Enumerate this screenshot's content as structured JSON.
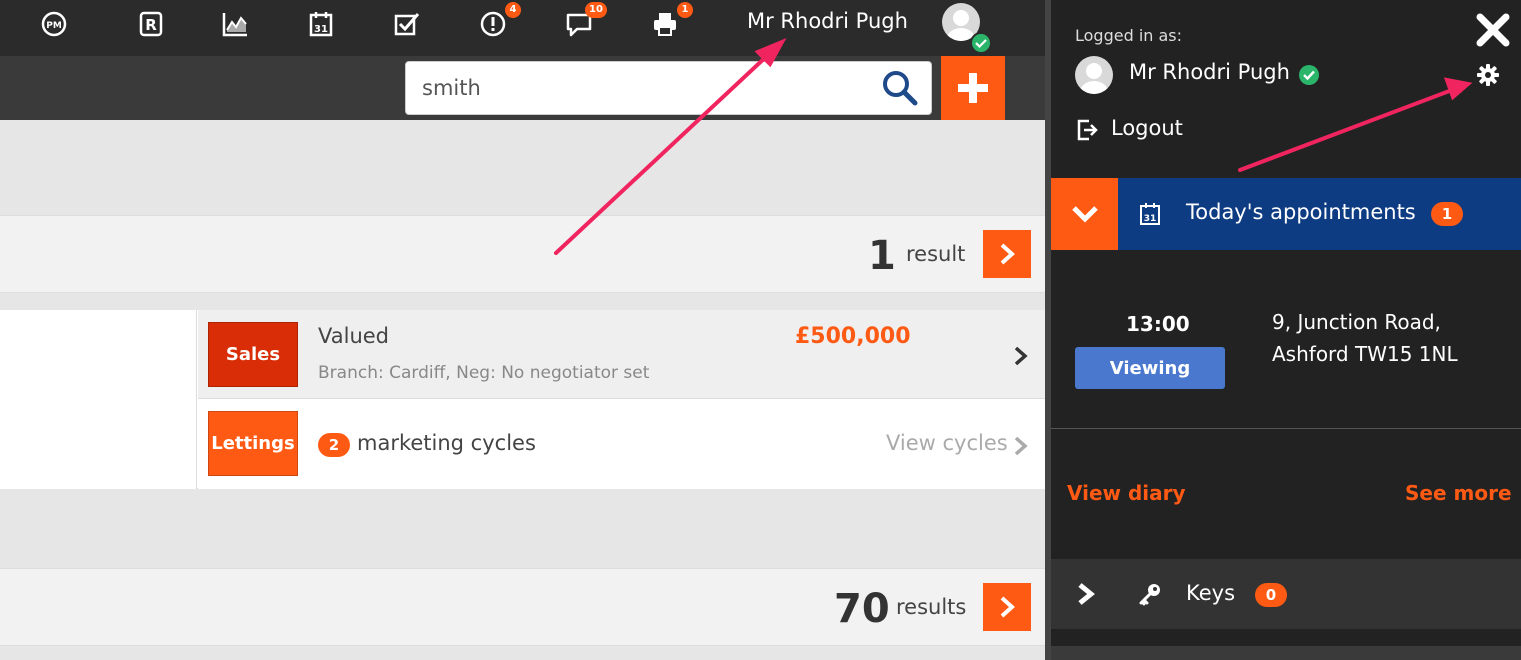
{
  "topbar": {
    "icons": [
      {
        "name": "pm-icon"
      },
      {
        "name": "r-icon"
      },
      {
        "name": "chart-icon"
      },
      {
        "name": "calendar-icon"
      },
      {
        "name": "tasks-icon"
      },
      {
        "name": "alerts-icon",
        "badge": "4"
      },
      {
        "name": "messages-icon",
        "badge": "10"
      },
      {
        "name": "printer-icon",
        "badge": "1"
      }
    ],
    "user_name": "Mr Rhodri Pugh"
  },
  "search": {
    "value": "smith",
    "placeholder": ""
  },
  "results": [
    {
      "count": "1",
      "label": "result"
    },
    {
      "count": "70",
      "label": "results"
    }
  ],
  "property": {
    "sales": {
      "tag": "Sales",
      "status": "Valued",
      "detail": "Branch:  Cardiff,  Neg:  No negotiator set",
      "price": "£500,000"
    },
    "lettings": {
      "tag": "Lettings",
      "cycles_count": "2",
      "cycles_label": "marketing cycles",
      "view_cycles": "View cycles"
    }
  },
  "panel": {
    "logged_in_as": "Logged in as:",
    "user_name": "Mr Rhodri Pugh",
    "logout": "Logout",
    "appointments": {
      "title": "Today's appointments",
      "count": "1",
      "items": [
        {
          "time": "13:00",
          "type": "Viewing",
          "address_line1": "9, Junction Road,",
          "address_line2": "Ashford TW15 1NL"
        }
      ],
      "view_diary": "View diary",
      "see_more": "See more"
    },
    "keys": {
      "label": "Keys",
      "count": "0"
    }
  },
  "colors": {
    "accent": "#ff5a14",
    "topbar": "#2b2b2b",
    "panel": "#222222",
    "appointments_header": "#0e3c82",
    "viewing": "#4a78cf",
    "sales_tag": "#d82d06",
    "status_ok": "#2ab56a",
    "annotation_arrow": "#f0245f"
  }
}
